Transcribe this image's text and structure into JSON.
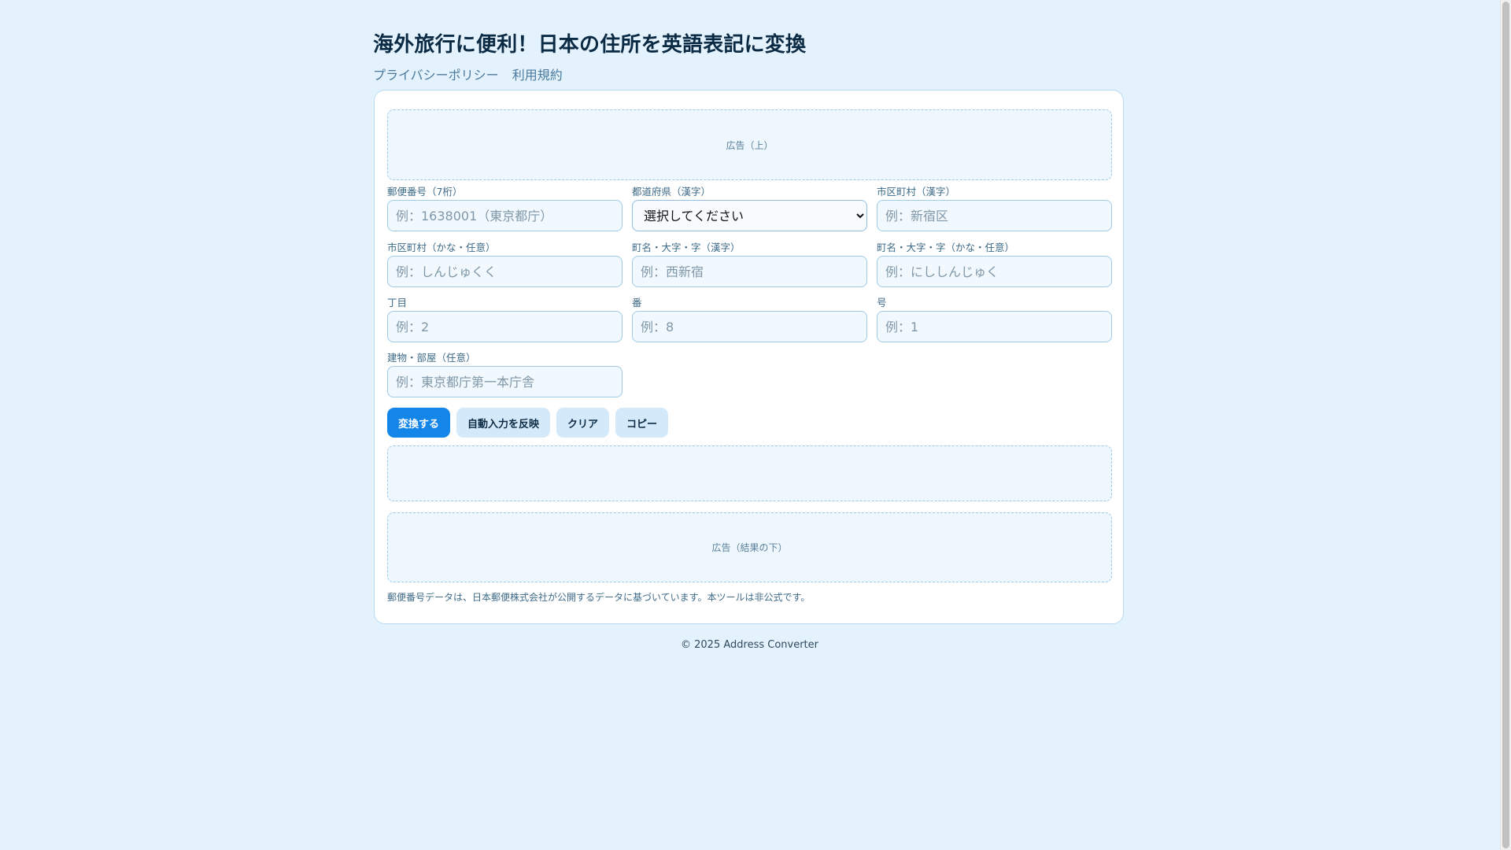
{
  "header": {
    "title": "海外旅行に便利！日本の住所を英語表記に変換",
    "nav": [
      "プライバシーポリシー",
      "利用規約"
    ]
  },
  "ads": {
    "top": "広告（上）",
    "bottom": "広告（結果の下）"
  },
  "form": {
    "postal": {
      "label": "郵便番号（7桁）",
      "placeholder": "例：1638001（東京都庁）",
      "value": ""
    },
    "prefecture": {
      "label": "都道府県（漢字）",
      "selected": "選択してください"
    },
    "city_kanji": {
      "label": "市区町村（漢字）",
      "placeholder": "例：新宿区",
      "value": ""
    },
    "city_kana": {
      "label": "市区町村（かな・任意）",
      "placeholder": "例：しんじゅくく",
      "value": ""
    },
    "town_kanji": {
      "label": "町名・大字・字（漢字）",
      "placeholder": "例：西新宿",
      "value": ""
    },
    "town_kana": {
      "label": "町名・大字・字（かな・任意）",
      "placeholder": "例：にししんじゅく",
      "value": ""
    },
    "chome": {
      "label": "丁目",
      "placeholder": "例：2",
      "value": ""
    },
    "ban": {
      "label": "番",
      "placeholder": "例：8",
      "value": ""
    },
    "go": {
      "label": "号",
      "placeholder": "例：1",
      "value": ""
    },
    "building": {
      "label": "建物・部屋（任意）",
      "placeholder": "例：東京都庁第一本庁舎",
      "value": ""
    }
  },
  "buttons": {
    "convert": "変換する",
    "apply_autofill": "自動入力を反映",
    "clear": "クリア",
    "copy": "コピー"
  },
  "result": "",
  "note": "郵便番号データは、日本郵便株式会社が公開するデータに基づいています。本ツールは非公式です。",
  "footer": "© 2025 Address Converter",
  "colors": {
    "background": "#e3f2fc",
    "primary_button": "#1486ea",
    "secondary_button": "#d4eafa",
    "input_border": "#9fcbe8"
  }
}
